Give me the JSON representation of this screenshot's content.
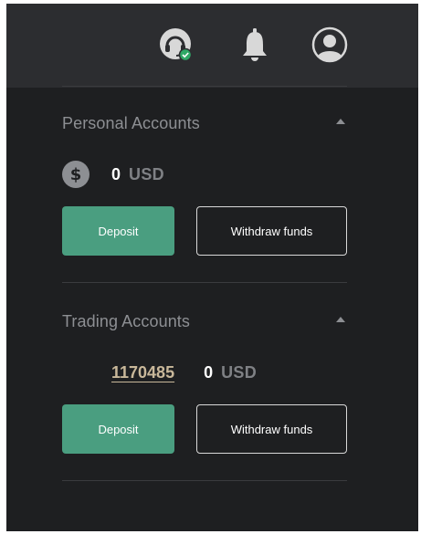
{
  "header": {
    "icons": [
      "support-headset-icon",
      "bell-icon",
      "user-avatar-icon"
    ],
    "support_status_color": "#2fa866"
  },
  "personal_accounts": {
    "title": "Personal Accounts",
    "amount": "0",
    "currency": "USD",
    "deposit_label": "Deposit",
    "withdraw_label": "Withdraw funds"
  },
  "trading_accounts": {
    "title": "Trading Accounts",
    "account_number": "1170485",
    "amount": "0",
    "currency": "USD",
    "deposit_label": "Deposit",
    "withdraw_label": "Withdraw funds"
  },
  "colors": {
    "panel_bg": "#1e1f21",
    "header_bg": "#2c2d30",
    "accent_green": "#4a9e80",
    "account_link": "#c9b89a"
  }
}
